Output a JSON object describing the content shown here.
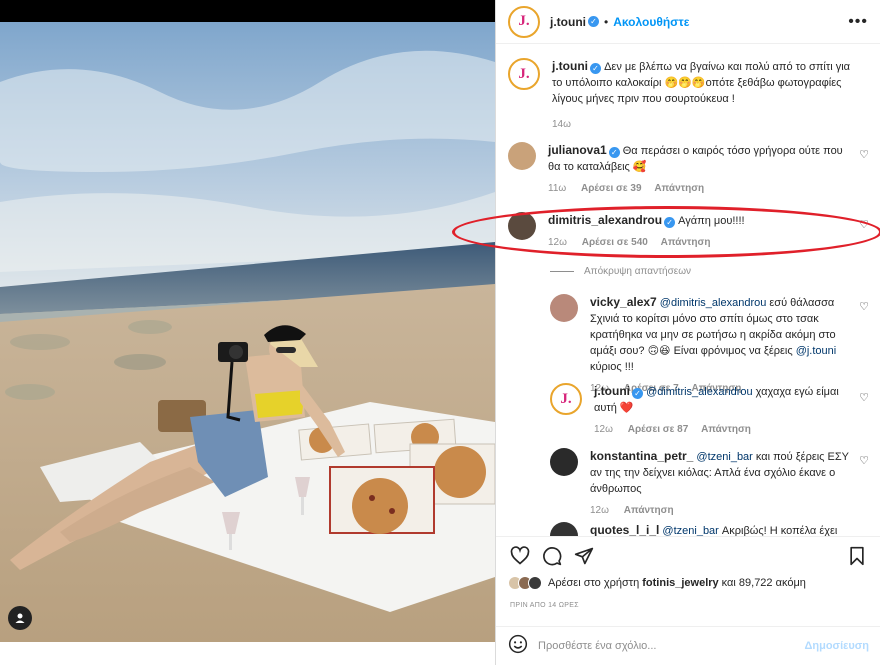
{
  "post": {
    "author": "j.touni",
    "author_avatar_letter": "J.",
    "follow_label": "Ακολουθήστε",
    "caption": "Δεν με βλέπω να βγαίνω και πολύ από το σπίτι για το υπόλοιπο καλοκαίρι 🤭🤭🤭οπότε ξεθάβω φωτογραφίες λίγους μήνες πριν που σουρτούκευα !",
    "caption_time": "14ω"
  },
  "comments": [
    {
      "user": "julianova1",
      "verified": true,
      "text": "Θα περάσει ο καιρός τόσο γρήγορα ούτε που θα το καταλάβεις 🥰",
      "time": "11ω",
      "likes": "Αρέσει σε 39",
      "reply": "Απάντηση",
      "avatar_color": "#c9a27a"
    },
    {
      "user": "dimitris_alexandrou",
      "verified": true,
      "text": "Αγάπη μου!!!!",
      "time": "12ω",
      "likes": "Αρέσει σε 540",
      "reply": "Απάντηση",
      "avatar_color": "#5a4a3e"
    }
  ],
  "hide_replies_label": "Απόκρυψη απαντήσεων",
  "replies": [
    {
      "user": "vicky_alex7",
      "verified": false,
      "mention": "@dimitris_alexandrou",
      "text": " εσύ θάλασσα Σχινιά το κορίτσι μόνο στο σπίτι όμως στο τσακ κρατήθηκα να μην σε ρωτήσω η ακρίδα ακόμη στο αμάξι σου? 🙃😆 Είναι φρόνιμος να ξέρεις ",
      "mention2": "@j.touni",
      "text2": " κύριος !!!",
      "time": "12ω",
      "likes": "Αρέσει σε 7",
      "reply": "Απάντηση",
      "avatar_color": "#b9897a"
    },
    {
      "user": "j.touni",
      "verified": true,
      "mention": "@dimitris_alexandrou",
      "text": " χαχαχα εγώ είμαι αυτή ❤️",
      "time": "12ω",
      "likes": "Αρέσει σε 87",
      "reply": "Απάντηση"
    },
    {
      "user": "konstantina_petr_",
      "verified": false,
      "mention": "@tzeni_bar",
      "text": " και πού ξέρεις ΕΣΥ αν της την δείχνει κιόλας: Απλά ένα σχόλιο έκανε ο άνθρωπος",
      "time": "12ω",
      "reply": "Απάντηση",
      "avatar_color": "#2a2a2a"
    },
    {
      "user": "quotes_l_i_l",
      "verified": false,
      "mention": "@tzeni_bar",
      "text": " Ακριβώς! Η κοπέλα έχει πάει",
      "avatar_color": "#333333"
    }
  ],
  "likes": {
    "prefix": "Αρέσει στο χρήστη ",
    "user": "fotinis_jewelry",
    "suffix": " και 89,722 ακόμη"
  },
  "time_ago": "ΠΡΙΝ ΑΠΟ 14 ΩΡΕΣ",
  "add_comment_placeholder": "Προσθέστε ένα σχόλιο...",
  "post_button": "Δημοσίευση",
  "colors": {
    "accent": "#0095f6",
    "highlight": "#e0202a",
    "verified": "#3897f0"
  },
  "icons": [
    "heart-icon",
    "comment-icon",
    "share-icon",
    "bookmark-icon",
    "emoji-icon",
    "more-icon",
    "user-tag-icon"
  ]
}
